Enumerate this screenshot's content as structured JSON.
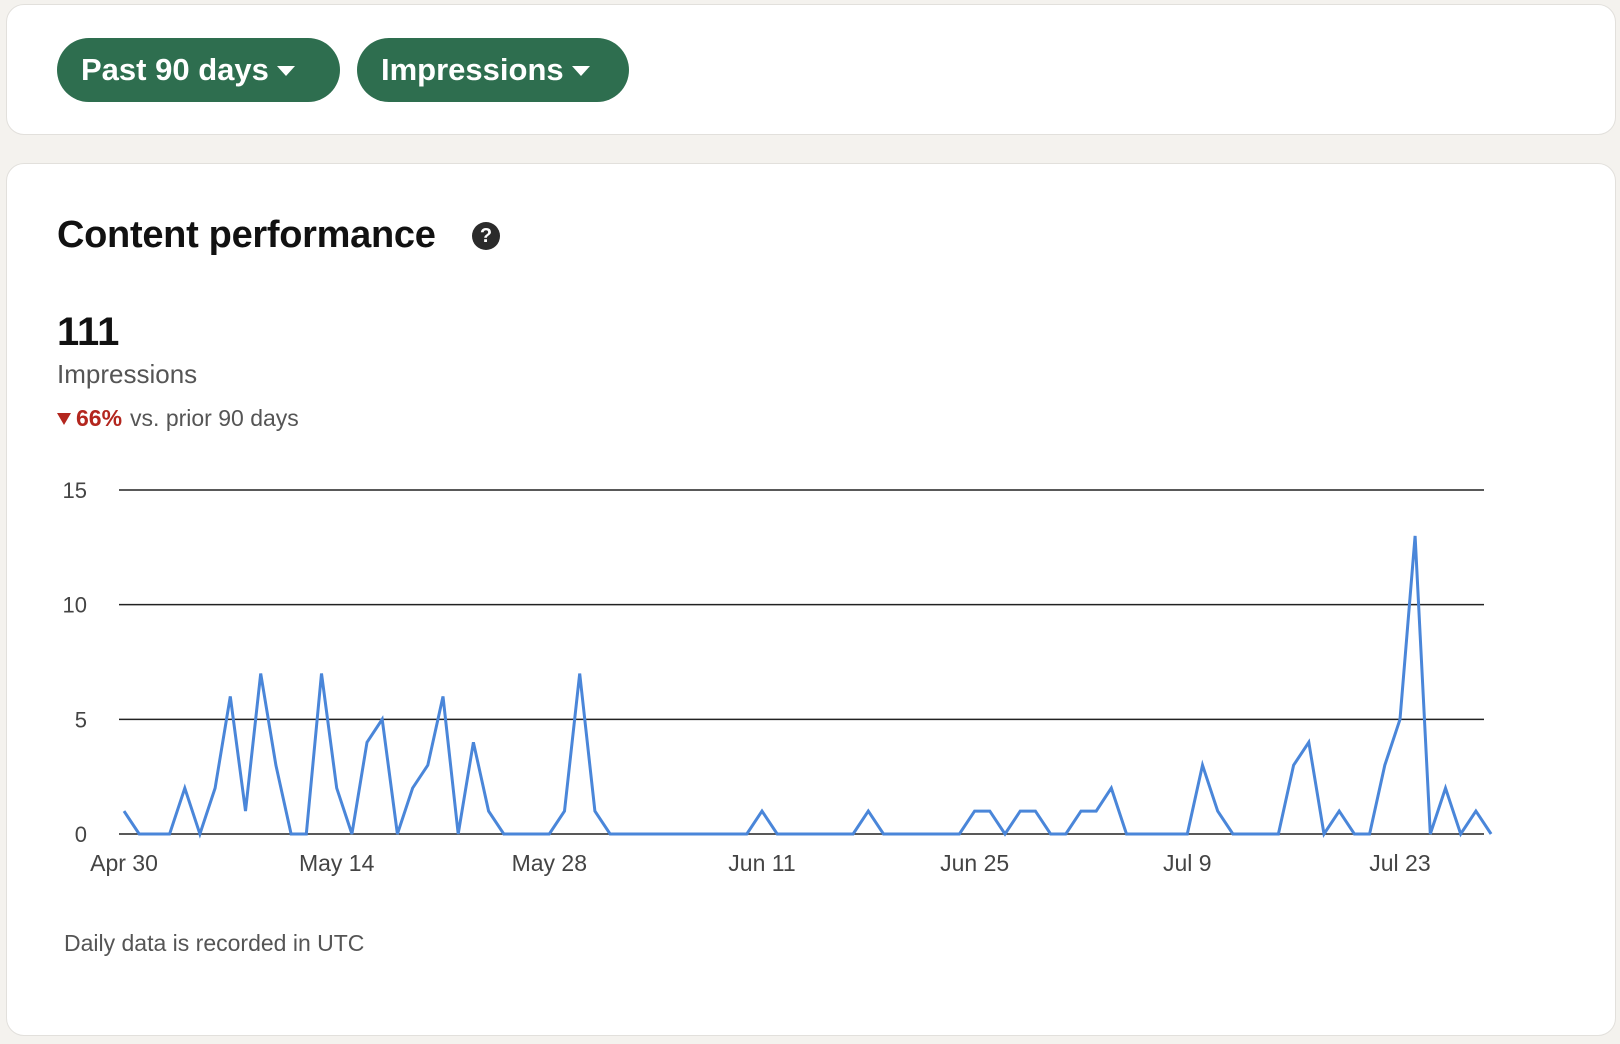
{
  "filters": {
    "range_label": "Past 90 days",
    "metric_label": "Impressions"
  },
  "card": {
    "title": "Content performance",
    "help_icon": "question-circle-icon",
    "total_value": "111",
    "total_label": "Impressions",
    "change_pct": "66%",
    "change_direction": "down",
    "change_text": "vs. prior 90 days",
    "footnote": "Daily data is recorded in UTC"
  },
  "colors": {
    "accent_green": "#2e6e4f",
    "line_blue": "#4a86d9",
    "negative_red": "#b3261e"
  },
  "chart_data": {
    "type": "line",
    "title": "",
    "xlabel": "",
    "ylabel": "",
    "ylim": [
      0,
      15
    ],
    "yticks": [
      0,
      5,
      10,
      15
    ],
    "grid": true,
    "x_tick_labels": [
      "Apr 30",
      "May 14",
      "May 28",
      "Jun 11",
      "Jun 25",
      "Jul 9",
      "Jul 23"
    ],
    "x_tick_day_index": [
      0,
      14,
      28,
      42,
      56,
      70,
      84
    ],
    "series": [
      {
        "values": [
          1,
          0,
          0,
          0,
          2,
          0,
          2,
          6,
          1,
          7,
          3,
          0,
          0,
          7,
          2,
          0,
          4,
          5,
          0,
          2,
          3,
          6,
          0,
          4,
          1,
          0,
          0,
          0,
          0,
          1,
          7,
          1,
          0,
          0,
          0,
          0,
          0,
          0,
          0,
          0,
          0,
          0,
          1,
          0,
          0,
          0,
          0,
          0,
          0,
          1,
          0,
          0,
          0,
          0,
          0,
          0,
          1,
          1,
          0,
          1,
          1,
          0,
          0,
          1,
          1,
          2,
          0,
          0,
          0,
          0,
          0,
          3,
          1,
          0,
          0,
          0,
          0,
          3,
          4,
          0,
          1,
          0,
          0,
          3,
          5,
          13,
          0,
          2,
          0,
          1,
          0
        ]
      }
    ]
  }
}
